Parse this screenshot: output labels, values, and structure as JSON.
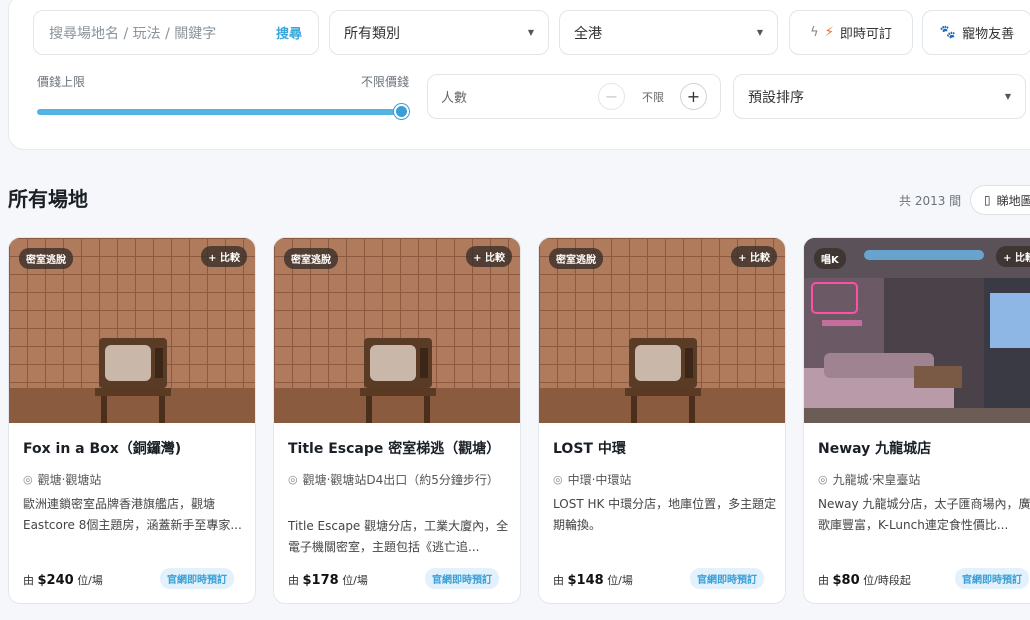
{
  "filters": {
    "search_placeholder": "搜尋場地名 / 玩法 / 關鍵字",
    "search_button": "搜尋",
    "category": "所有類別",
    "region": "全港",
    "instant_label": "即時可訂",
    "pet_label": "寵物友善",
    "price_label": "價錢上限",
    "price_max_label": "不限價錢",
    "price_level_percent": 100,
    "people_label": "人數",
    "people_value": "不限",
    "sort": "預設排序"
  },
  "section": {
    "title": "所有場地",
    "count": "共 2013 間",
    "map_button": "睇地圖"
  },
  "cards": [
    {
      "tag": "密室逃脫",
      "compare": "+ 比較",
      "title": "Fox in a Box（銅鑼灣)",
      "location": "觀塘‧觀塘站",
      "description": "歐洲連鎖密室品牌香港旗艦店，觀塘 Eastcore 8個主題房，涵蓋新手至專家...",
      "price_prefix": "由",
      "price": "$240",
      "price_unit": "位/場",
      "book": "官網即時預訂"
    },
    {
      "tag": "密室逃脫",
      "compare": "+ 比較",
      "title": "Title Escape 密室梯逃（觀塘）",
      "location": "觀塘‧觀塘站D4出口（約5分鐘步行）",
      "description": "Title Escape 觀塘分店，工業大廈內，全電子機關密室，主題包括《逃亡追...",
      "price_prefix": "由",
      "price": "$178",
      "price_unit": "位/場",
      "book": "官網即時預訂"
    },
    {
      "tag": "密室逃脫",
      "compare": "+ 比較",
      "title": "LOST 中環",
      "location": "中環‧中環站",
      "description": "LOST HK 中環分店，地庫位置，多主題定期輪換。",
      "price_prefix": "由",
      "price": "$148",
      "price_unit": "位/場",
      "book": "官網即時預訂"
    },
    {
      "tag": "唱K",
      "compare": "+ 比較",
      "title": "Neway 九龍城店",
      "location": "九龍城‧宋皇臺站",
      "description": "Neway 九龍城分店，太子匯商場內，廣東歌庫豐富，K-Lunch連定食性價比...",
      "price_prefix": "由",
      "price": "$80",
      "price_unit": "位/時段起",
      "book": "官網即時預訂"
    }
  ]
}
